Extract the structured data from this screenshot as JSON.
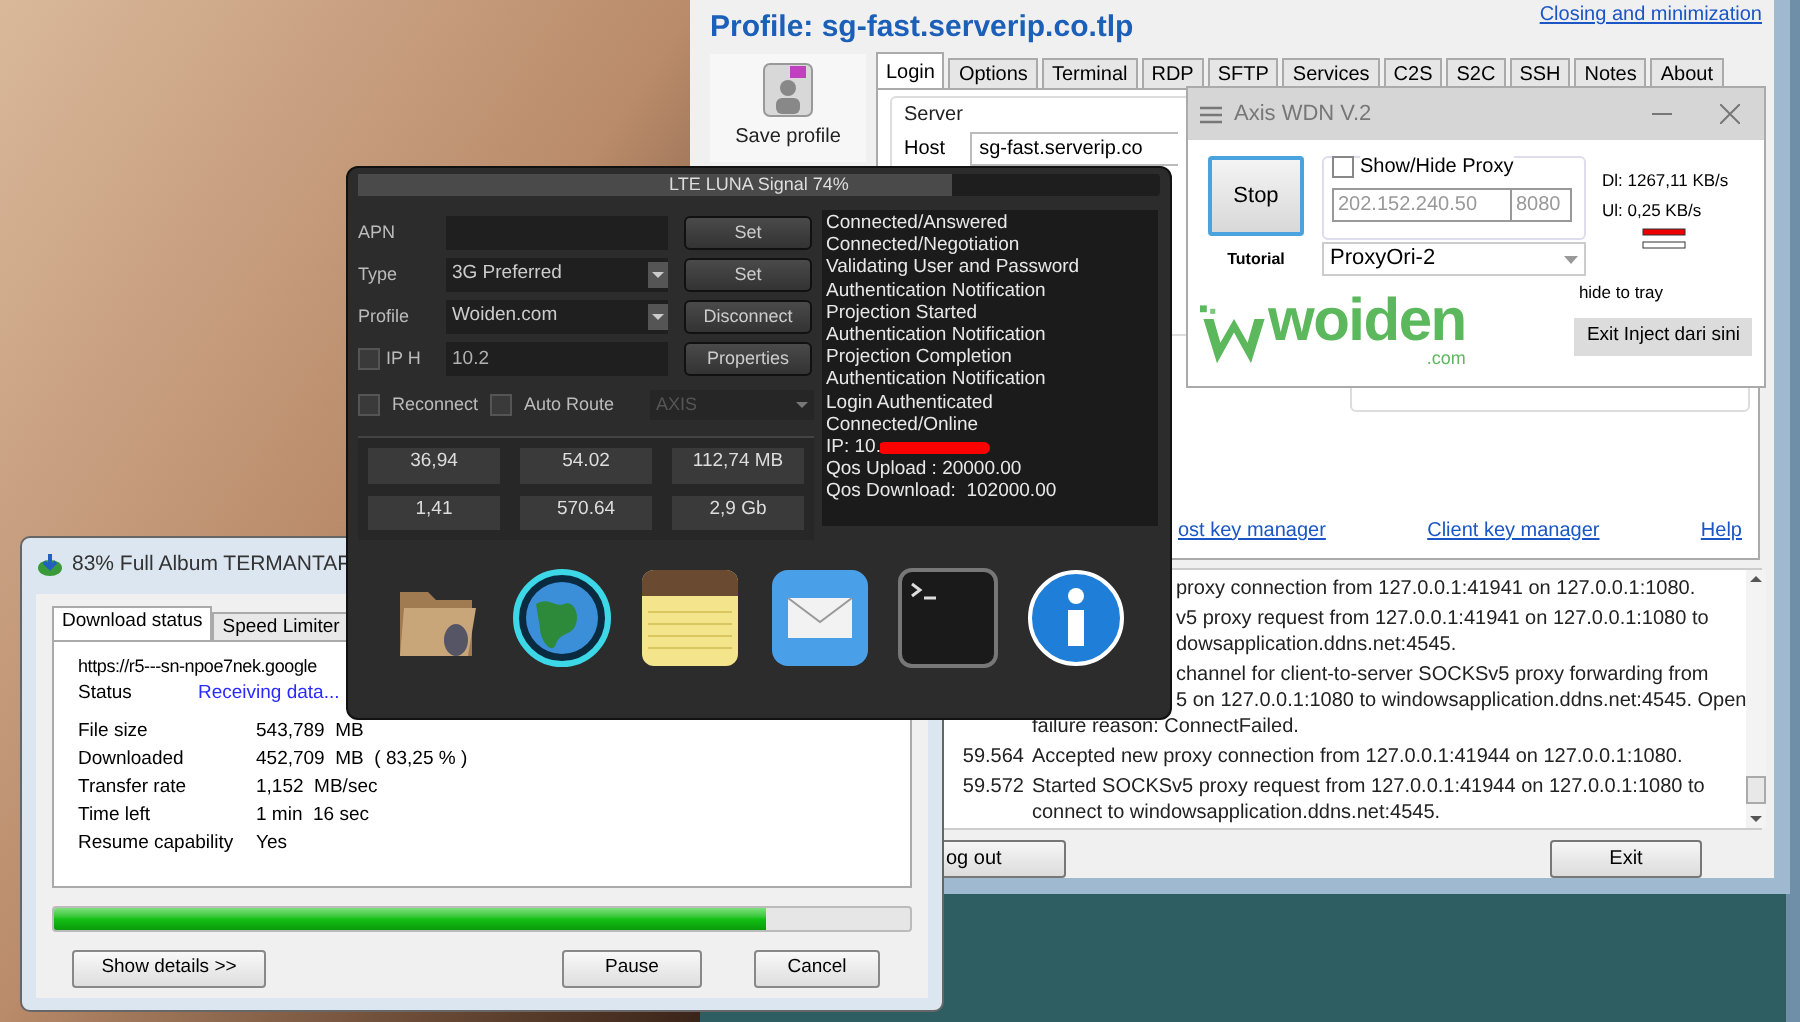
{
  "ssh_client": {
    "profile_title": "Profile: sg-fast.serverip.co.tlp",
    "top_link": "Closing and minimization",
    "save_profile": "Save profile",
    "tabs": [
      {
        "label": "Login",
        "selected": true
      },
      {
        "label": "Options",
        "selected": false
      },
      {
        "label": "Terminal",
        "selected": false
      },
      {
        "label": "RDP",
        "selected": false
      },
      {
        "label": "SFTP",
        "selected": false
      },
      {
        "label": "Services",
        "selected": false
      },
      {
        "label": "C2S",
        "selected": false
      },
      {
        "label": "S2C",
        "selected": false
      },
      {
        "label": "SSH",
        "selected": false
      },
      {
        "label": "Notes",
        "selected": false
      },
      {
        "label": "About",
        "selected": false
      }
    ],
    "server_group": "Server",
    "host_label": "Host",
    "host_value": "sg-fast.serverip.co",
    "links": [
      "ost key manager",
      "Client key manager",
      "Help"
    ],
    "log": [
      {
        "lines": [
          {
            "kind": "covered",
            "text": "proxy connection from 127.0.0.1:41941 on 127.0.0.1:1080."
          }
        ]
      },
      {
        "lines": [
          {
            "kind": "covered",
            "text": "v5 proxy request from 127.0.0.1:41941 on 127.0.0.1:1080 to"
          },
          {
            "kind": "covered",
            "text": "dowsapplication.ddns.net:4545."
          }
        ]
      },
      {
        "lines": [
          {
            "kind": "covered",
            "text": "channel for client-to-server SOCKSv5 proxy forwarding from"
          },
          {
            "kind": "covered",
            "text": "5 on 127.0.0.1:1080 to windowsapplication.ddns.net:4545. Open"
          },
          {
            "kind": "open",
            "text": "failure reason: ConnectFailed."
          }
        ]
      },
      {
        "time": "59.564",
        "lines": [
          {
            "kind": "open",
            "text": "Accepted new proxy connection from 127.0.0.1:41944 on 127.0.0.1:1080."
          }
        ]
      },
      {
        "time": "59.572",
        "lines": [
          {
            "kind": "open",
            "text": "Started SOCKSv5 proxy request from 127.0.0.1:41944 on 127.0.0.1:1080 to"
          },
          {
            "kind": "open",
            "text": "connect to windowsapplication.ddns.net:4545."
          }
        ]
      }
    ],
    "buttons": [
      "og out",
      "Exit"
    ]
  },
  "injector": {
    "title": "Axis WDN V.2",
    "stop": "Stop",
    "tutorial": "Tutorial",
    "show_hide": {
      "label": "Show/Hide Proxy",
      "checked": false
    },
    "proxy_host": "202.152.240.50",
    "proxy_port": "8080",
    "proxy_select": "ProxyOri-2",
    "download_rate": "Dl: 1267,11 KB/s",
    "upload_rate": "Ul: 0,25 KB/s",
    "logo": {
      "name": "woiden",
      "suffix": ".com"
    },
    "hide_to_tray": "hide to tray",
    "exit_button": "Exit Inject dari sini"
  },
  "modem": {
    "title": "LTE LUNA Signal 74%",
    "level": 0.74,
    "fields": [
      {
        "kind": "input",
        "label": "APN"
      },
      {
        "kind": "select",
        "label": "Type",
        "value": "3G Preferred"
      },
      {
        "kind": "select",
        "label": "Profile",
        "value": "Woiden.com"
      },
      {
        "kind": "check",
        "label": "IP H",
        "checked": false,
        "value": "10.2"
      }
    ],
    "buttons": [
      "Set",
      "Set",
      "Disconnect",
      "Properties"
    ],
    "reconnect": {
      "label": "Reconnect",
      "checked": false
    },
    "auto_route": {
      "label": "Auto Route",
      "checked": false
    },
    "route_select": "AXIS",
    "stats": [
      "36,94",
      "54.02",
      "112,74 MB",
      "1,41",
      "570.64",
      "2,9 Gb"
    ],
    "log": [
      {
        "kind": "text",
        "text": "Connected/Answered"
      },
      {
        "kind": "text",
        "text": "Connected/Negotiation"
      },
      {
        "kind": "text",
        "text": "Validating User and Password"
      },
      {
        "kind": "text",
        "text": "Authentication Notification"
      },
      {
        "kind": "text",
        "text": "Projection Started"
      },
      {
        "kind": "text",
        "text": "Authentication Notification"
      },
      {
        "kind": "text",
        "text": "Projection Completion"
      },
      {
        "kind": "text",
        "text": "Authentication Notification"
      },
      {
        "kind": "text",
        "text": "Login Authenticated"
      },
      {
        "kind": "text",
        "text": "Connected/Online"
      },
      {
        "kind": "redacted",
        "text": "IP: 10."
      },
      {
        "kind": "text",
        "text": "Qos Upload : 20000.00"
      },
      {
        "kind": "text",
        "text": "Qos Download:  102000.00"
      }
    ]
  },
  "downloader": {
    "title": "83% Full Album TERMANTAP",
    "tabs": [
      {
        "label": "Download status",
        "selected": true
      },
      {
        "label": "Speed Limiter",
        "selected": false
      }
    ],
    "url": "https://r5---sn-npoe7nek.google",
    "status": {
      "label": "Status",
      "value": "Receiving data..."
    },
    "details": [
      {
        "label": "File size",
        "value": "543,789  MB"
      },
      {
        "label": "Downloaded",
        "value": "452,709  MB  ( 83,25 % )"
      },
      {
        "label": "Transfer rate",
        "value": "1,152  MB/sec"
      },
      {
        "label": "Time left",
        "value": "1 min  16 sec"
      },
      {
        "label": "Resume capability",
        "value": "Yes"
      }
    ],
    "level": 0.8325,
    "buttons": [
      "Show details >>",
      "Pause",
      "Cancel"
    ]
  }
}
